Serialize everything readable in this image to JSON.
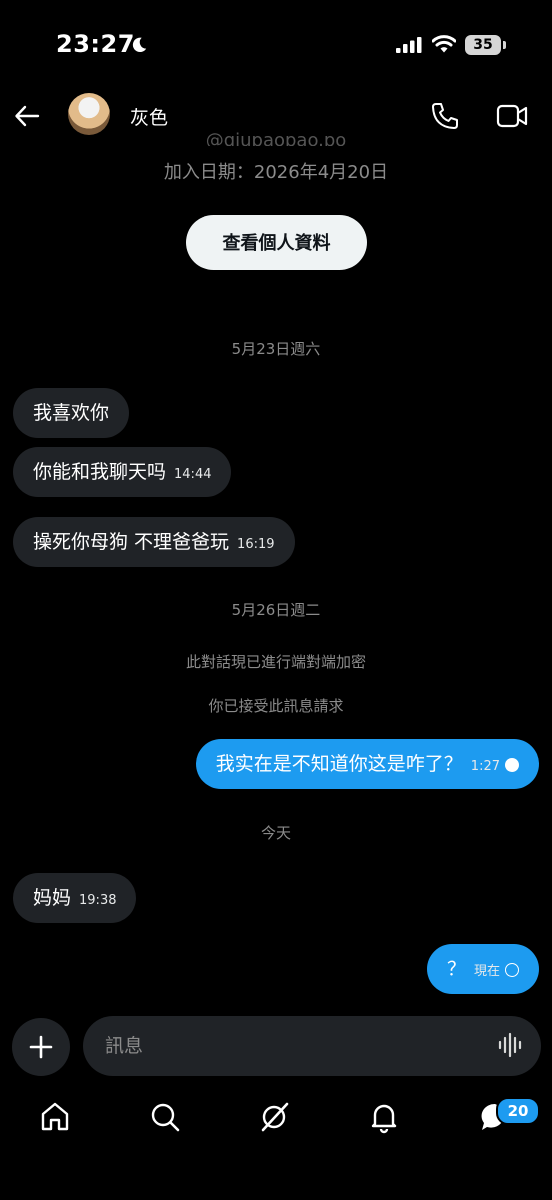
{
  "status_bar": {
    "time": "23:27",
    "battery": "35"
  },
  "header": {
    "name": "灰色",
    "back_icon": "arrow-left-icon",
    "call_icon": "phone-icon",
    "video_icon": "video-icon"
  },
  "profile": {
    "handle": "@qiupaopao.po",
    "joined": "加入日期：2026年4月20日",
    "view_profile_label": "查看個人資料"
  },
  "conversation": {
    "date_1": "5月23日週六",
    "date_2": "5月26日週二",
    "encryption_notice": "此對話現已進行端對端加密",
    "accepted_notice": "你已接受此訊息請求",
    "date_3": "今天",
    "messages": [
      {
        "text": "我喜欢你",
        "time": ""
      },
      {
        "text": "你能和我聊天吗",
        "time": "14:44"
      },
      {
        "text": "操死你母狗 不理爸爸玩",
        "time": "16:19"
      },
      {
        "text": "我实在是不知道你这是咋了？",
        "time": "1:27"
      },
      {
        "text": "妈妈",
        "time": "19:38"
      },
      {
        "text": "？",
        "time": "現在"
      }
    ]
  },
  "composer": {
    "placeholder": "訊息"
  },
  "nav": {
    "notification_count": "20"
  },
  "colors": {
    "accent": "#1d9bf0",
    "bubble_in": "#202327",
    "background": "#000000"
  }
}
